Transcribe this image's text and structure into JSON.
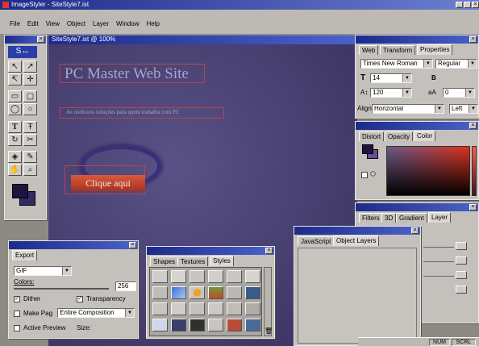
{
  "app": {
    "title": "ImageStyler - SiteStyle7.ist",
    "menu": [
      "File",
      "Edit",
      "View",
      "Object",
      "Layer",
      "Window",
      "Help"
    ]
  },
  "document": {
    "title": "SiteStyle7.ist @ 100%",
    "heading": "PC Master Web Site",
    "subtitle": "As melhores soluções para quem trabalha com PC",
    "button_label": "Clique aqui",
    "bg_color": "#4a4170"
  },
  "text_panel": {
    "tabs": [
      "Web",
      "Transform",
      "Properties"
    ],
    "font": "Times New Roman",
    "style": "Regular",
    "size": "14",
    "leading": "120",
    "tracking": "0",
    "align_label": "Align",
    "align_value": "Horizontal",
    "justify": "Left"
  },
  "color_panel": {
    "tabs": [
      "Distort",
      "Opacity",
      "Color"
    ]
  },
  "layer_panel": {
    "tabs": [
      "Filters",
      "3D",
      "Gradient",
      "Layer"
    ]
  },
  "export_panel": {
    "tabs": [
      "Export"
    ],
    "format": "GIF",
    "colors_label": "Colors:",
    "colors_value": "256",
    "dither_label": "Dither",
    "transparency_label": "Transparency",
    "make_page_label": "Make Pag",
    "make_page_value": "Entire Composition",
    "active_preview_label": "Active Preview",
    "size_label": "Size:"
  },
  "styles_panel": {
    "tabs": [
      "Shapes",
      "Textures",
      "Styles"
    ]
  },
  "object_panel": {
    "tabs": [
      "JavaScript",
      "Object Layers"
    ]
  },
  "status": {
    "num": "NUM",
    "scrl": "SCRL"
  }
}
